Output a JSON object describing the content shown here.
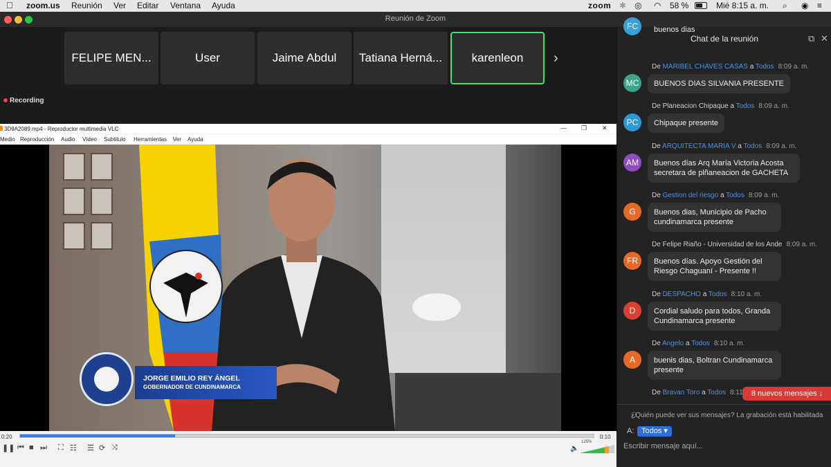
{
  "menubar": {
    "apple": "",
    "app": "zoom.us",
    "items": [
      "Reunión",
      "Ver",
      "Editar",
      "Ventana",
      "Ayuda"
    ],
    "zoom_label": "zoom",
    "battery": "58 %",
    "clock": "Mié 8:15 a. m."
  },
  "window": {
    "title": "Reunión de Zoom"
  },
  "participants": [
    "FELIPE MEN...",
    "User",
    "Jaime Abdul",
    "Tatiana Herná...",
    "karenleon"
  ],
  "strip_next": "›",
  "recording": "Recording",
  "vlc": {
    "title": "3D9A2089.mp4 - Reproductor multimedia VLC",
    "menu": [
      "Medio",
      "Reproducción",
      "Audio",
      "Vídeo",
      "Subtítulo",
      "Herramientas",
      "Ver",
      "Ayuda"
    ],
    "time_elapsed": "0:20",
    "time_total": "0:10",
    "volume": "125%",
    "progress_fraction": 0.27,
    "lower_third_name": "JORGE EMILIO REY ÁNGEL",
    "lower_third_role": "GOBERNADOR DE CUNDINAMARCA"
  },
  "chat": {
    "title": "Chat de la reunión",
    "from": "De",
    "to": "a",
    "messages": [
      {
        "avatar": "FC",
        "color": "#3aa0d8",
        "sender": "",
        "recipient": "",
        "time": "",
        "text": "buenos dias"
      },
      {
        "avatar": "MC",
        "color": "#3aa38a",
        "sender": "MARIBEL CHAVES CASAS",
        "recipient": "Todos",
        "time": "8:09 a. m.",
        "text": "BUENOS DIAS SILVANIA PRESENTE"
      },
      {
        "avatar": "PC",
        "color": "#2f97d6",
        "sender": "Planeacion Chipaque",
        "recipient": "Todos",
        "time": "8:09 a. m.",
        "text": "Chipaque presente"
      },
      {
        "avatar": "AM",
        "color": "#8e4bc2",
        "sender": "ARQUITECTA MARIA V",
        "recipient": "Todos",
        "time": "8:09 a. m.",
        "text": "Buenos días Arq María Victoria Acosta secretara de plñaneacion de GACHETA"
      },
      {
        "avatar": "G",
        "color": "#e56a2a",
        "sender": "Gestion del riesgo",
        "recipient": "Todos",
        "time": "8:09 a. m.",
        "text": "Buenos dias, Municipio de Pacho cundinamarca presente"
      },
      {
        "avatar": "FR",
        "color": "#e56a2a",
        "sender": "Felipe Riaño - Universidad de los Ande",
        "recipient": "",
        "time": "8:09 a. m.",
        "text": "Buenos días. Apoyo Gestión del Riesgo Chaguaní - Presente !!"
      },
      {
        "avatar": "D",
        "color": "#d8402f",
        "sender": "DESPACHO",
        "recipient": "Todos",
        "time": "8:10 a. m.",
        "text": "Cordial saludo para todos, Granda Cundinamarca presente"
      },
      {
        "avatar": "A",
        "color": "#e56a2a",
        "sender": "Angelo",
        "recipient": "Todos",
        "time": "8:10 a. m.",
        "text": "buenis dias, Boltran Cundinamarca presente"
      },
      {
        "avatar": "",
        "color": "#2f97d6",
        "sender": "Bravan Toro",
        "recipient": "Todos",
        "time": "8:11 a. m.",
        "text": ""
      }
    ],
    "new_messages": "8 nuevos mensajes ↓",
    "privacy": "¿Quién puede ver sus mensajes? La grabación está habilitada",
    "to_label": "A:",
    "to_value": "Todos ▾",
    "input_placeholder": "Escribir mensaje aquí..."
  }
}
